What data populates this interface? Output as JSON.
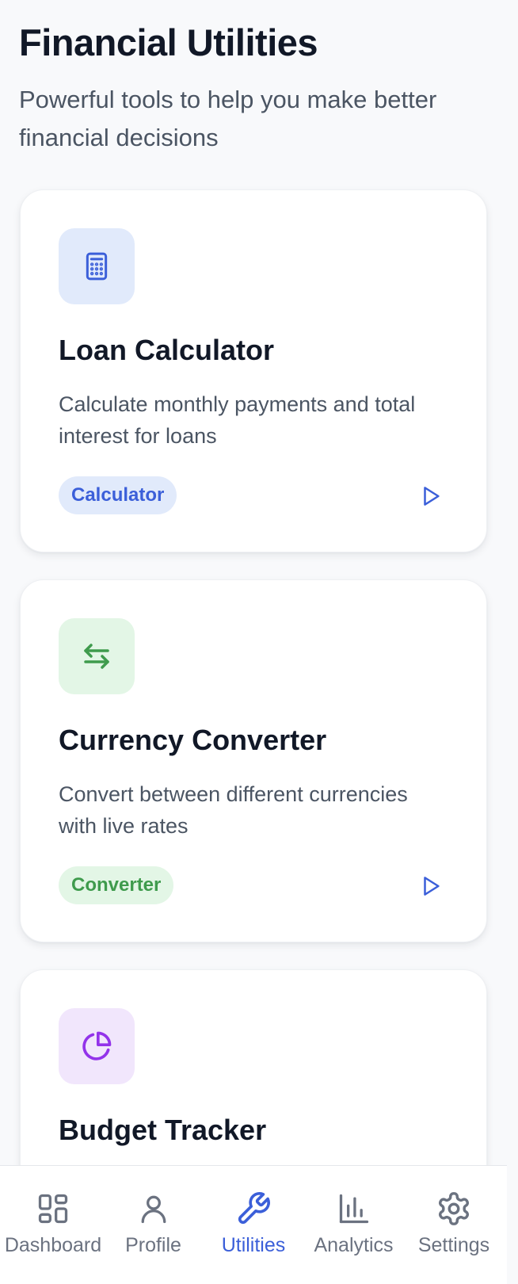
{
  "header": {
    "title": "Financial Utilities",
    "subtitle": "Powerful tools to help you make better financial decisions"
  },
  "tools": [
    {
      "name": "Loan Calculator",
      "description": "Calculate monthly payments and total interest for loans",
      "tag": "Calculator",
      "icon": "calculator-icon",
      "accent": "#3b5fd9",
      "icon_bg": "#e1eafb",
      "tag_bg": "#e1eafb"
    },
    {
      "name": "Currency Converter",
      "description": "Convert between different currencies with live rates",
      "tag": "Converter",
      "icon": "swap-arrows-icon",
      "accent": "#3f9b4d",
      "icon_bg": "#e3f6e6",
      "tag_bg": "#e3f6e6"
    },
    {
      "name": "Budget Tracker",
      "icon": "pie-chart-icon",
      "accent": "#9333ea",
      "icon_bg": "#f1e6fc"
    }
  ],
  "nav": {
    "items": [
      {
        "label": "Dashboard",
        "icon": "dashboard-icon"
      },
      {
        "label": "Profile",
        "icon": "user-icon"
      },
      {
        "label": "Utilities",
        "icon": "wrench-icon",
        "active": true
      },
      {
        "label": "Analytics",
        "icon": "bar-chart-icon"
      },
      {
        "label": "Settings",
        "icon": "gear-icon"
      }
    ]
  },
  "colors": {
    "primary": "#3b5fd9",
    "text": "#111827",
    "muted": "#4b5563",
    "nav_inactive": "#6b7280",
    "background": "#f8f9fb"
  }
}
